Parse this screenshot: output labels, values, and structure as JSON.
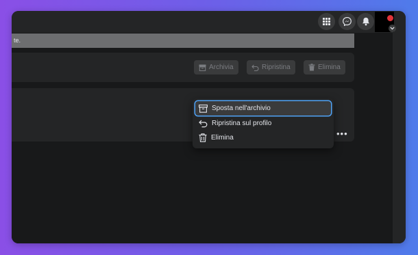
{
  "notice": {
    "text": "te."
  },
  "actions": {
    "archive_label": "Archivia",
    "restore_label": "Ripristina",
    "delete_label": "Elimina"
  },
  "context_menu": {
    "items": [
      {
        "label": "Sposta nell'archivio",
        "icon": "archive-icon"
      },
      {
        "label": "Ripristina sul profilo",
        "icon": "undo-icon"
      },
      {
        "label": "Elimina",
        "icon": "trash-icon"
      }
    ],
    "focused_index": 0
  },
  "colors": {
    "focus": "#4fa3f7",
    "accent_red": "#e0343a"
  }
}
